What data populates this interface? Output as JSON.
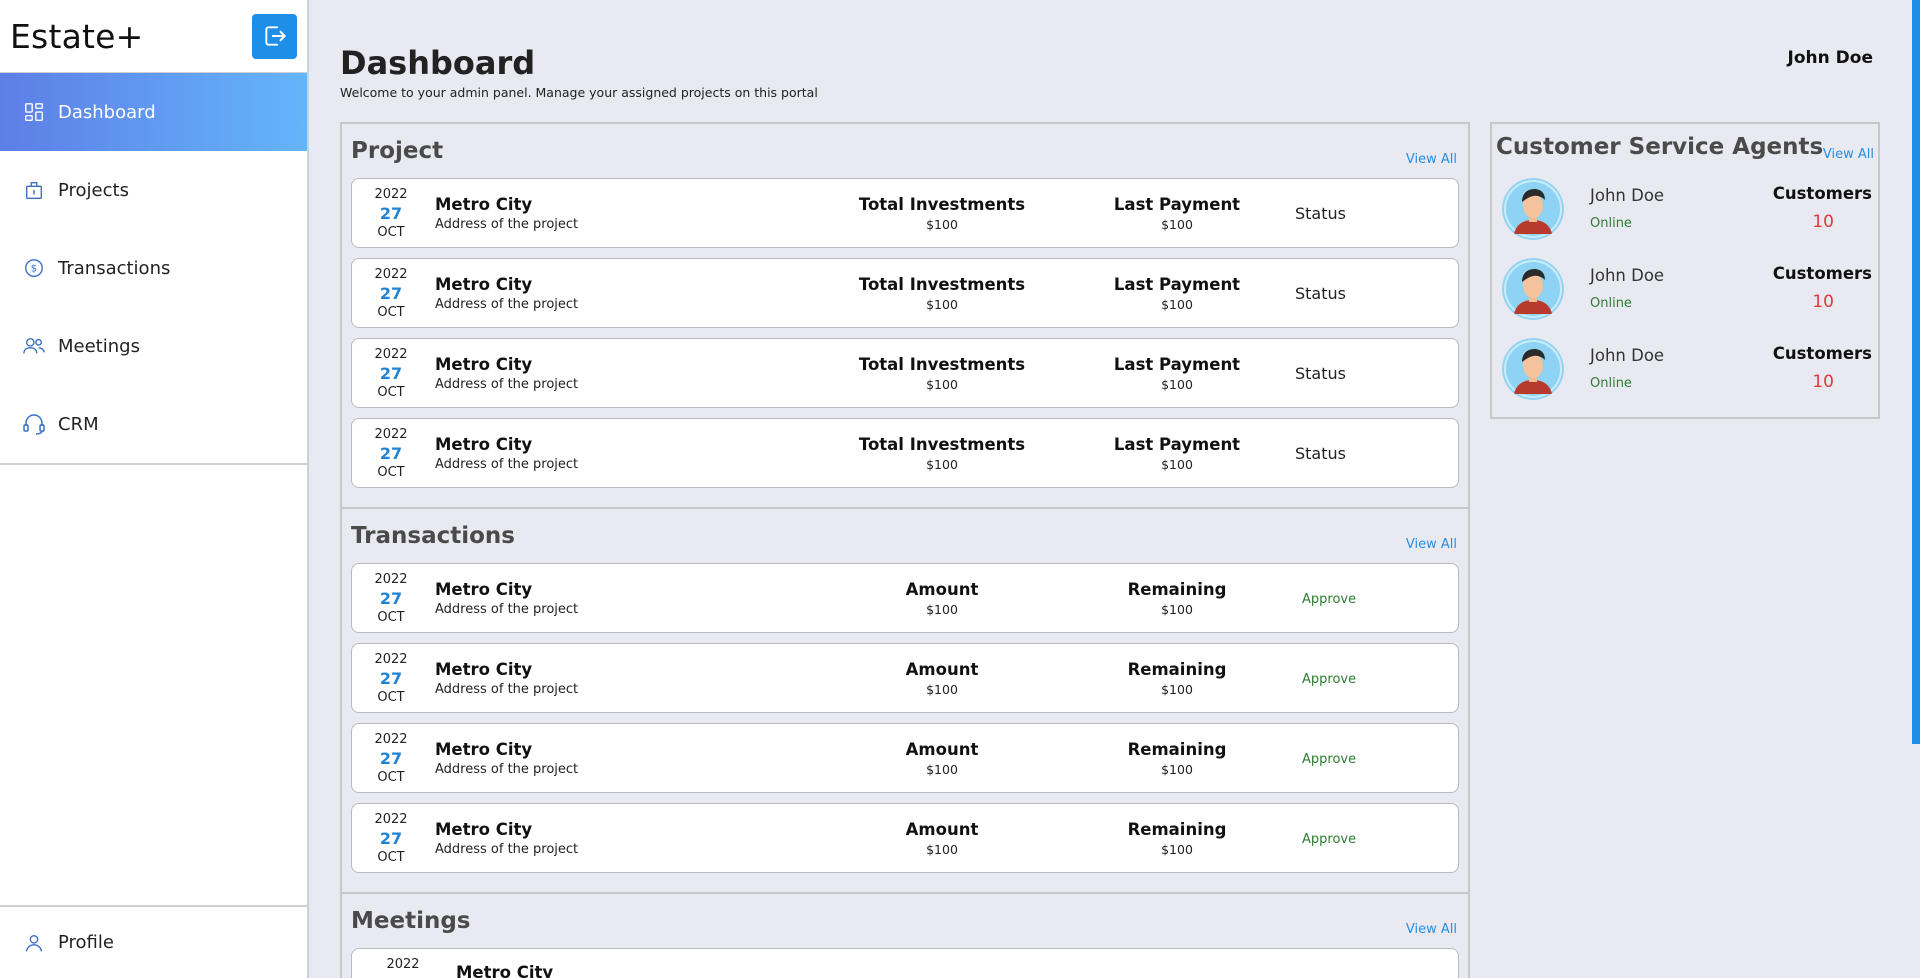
{
  "brand": "Estate+",
  "sidebar": {
    "items": [
      {
        "label": "Dashboard",
        "icon": "dashboard-icon",
        "active": true
      },
      {
        "label": "Projects",
        "icon": "projects-icon",
        "active": false
      },
      {
        "label": "Transactions",
        "icon": "dollar-icon",
        "active": false
      },
      {
        "label": "Meetings",
        "icon": "people-icon",
        "active": false
      },
      {
        "label": "CRM",
        "icon": "headset-icon",
        "active": false
      }
    ],
    "profile_label": "Profile"
  },
  "header": {
    "title": "Dashboard",
    "subtitle": "Welcome to your admin panel. Manage your assigned projects on this portal",
    "user": "John Doe"
  },
  "project": {
    "title": "Project",
    "view_all": "View All",
    "rows": [
      {
        "year": "2022",
        "day": "27",
        "month": "OCT",
        "name": "Metro City",
        "address": "Address of the project",
        "h1": "Total Investments",
        "v1": "$100",
        "h2": "Last Payment",
        "v2": "$100",
        "status": "Status"
      },
      {
        "year": "2022",
        "day": "27",
        "month": "OCT",
        "name": "Metro City",
        "address": "Address of the project",
        "h1": "Total Investments",
        "v1": "$100",
        "h2": "Last Payment",
        "v2": "$100",
        "status": "Status"
      },
      {
        "year": "2022",
        "day": "27",
        "month": "OCT",
        "name": "Metro City",
        "address": "Address of the project",
        "h1": "Total Investments",
        "v1": "$100",
        "h2": "Last Payment",
        "v2": "$100",
        "status": "Status"
      },
      {
        "year": "2022",
        "day": "27",
        "month": "OCT",
        "name": "Metro City",
        "address": "Address of the project",
        "h1": "Total Investments",
        "v1": "$100",
        "h2": "Last Payment",
        "v2": "$100",
        "status": "Status"
      }
    ]
  },
  "transactions": {
    "title": "Transactions",
    "view_all": "View All",
    "rows": [
      {
        "year": "2022",
        "day": "27",
        "month": "OCT",
        "name": "Metro City",
        "address": "Address of the project",
        "h1": "Amount",
        "v1": "$100",
        "h2": "Remaining",
        "v2": "$100",
        "action": "Approve"
      },
      {
        "year": "2022",
        "day": "27",
        "month": "OCT",
        "name": "Metro City",
        "address": "Address of the project",
        "h1": "Amount",
        "v1": "$100",
        "h2": "Remaining",
        "v2": "$100",
        "action": "Approve"
      },
      {
        "year": "2022",
        "day": "27",
        "month": "OCT",
        "name": "Metro City",
        "address": "Address of the project",
        "h1": "Amount",
        "v1": "$100",
        "h2": "Remaining",
        "v2": "$100",
        "action": "Approve"
      },
      {
        "year": "2022",
        "day": "27",
        "month": "OCT",
        "name": "Metro City",
        "address": "Address of the project",
        "h1": "Amount",
        "v1": "$100",
        "h2": "Remaining",
        "v2": "$100",
        "action": "Approve"
      }
    ]
  },
  "meetings": {
    "title": "Meetings",
    "view_all": "View All",
    "rows": [
      {
        "year": "2022",
        "name": "Metro City"
      }
    ]
  },
  "agents": {
    "title": "Customer Service Agents",
    "view_all": "View All",
    "list": [
      {
        "name": "John Doe",
        "status": "Online",
        "customers_label": "Customers",
        "customers": "10"
      },
      {
        "name": "John Doe",
        "status": "Online",
        "customers_label": "Customers",
        "customers": "10"
      },
      {
        "name": "John Doe",
        "status": "Online",
        "customers_label": "Customers",
        "customers": "10"
      }
    ]
  },
  "colors": {
    "accent": "#1e8fe8",
    "active_gradient_start": "#5d7ee6",
    "active_gradient_end": "#64b5fb",
    "online": "#2e7d32",
    "count": "#e53935"
  }
}
